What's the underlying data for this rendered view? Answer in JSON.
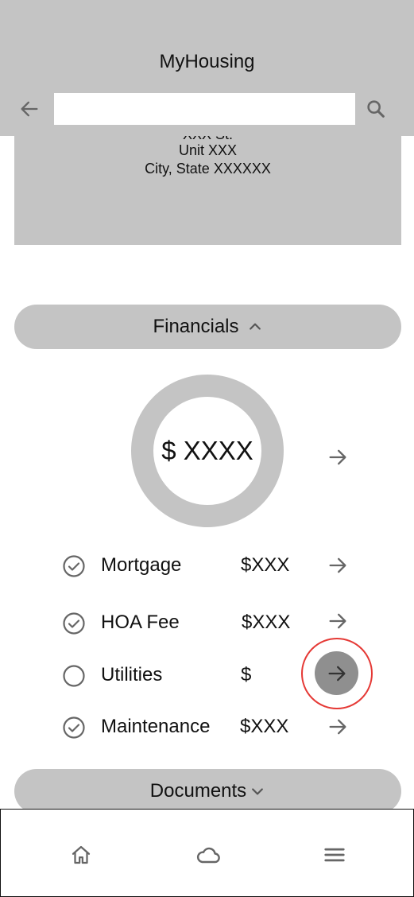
{
  "header": {
    "title": "MyHousing",
    "search": {
      "value": "",
      "placeholder": ""
    }
  },
  "address": {
    "line1": "XXX St.",
    "line2": "Unit XXX",
    "line3": "City, State XXXXXX"
  },
  "financials": {
    "label": "Financials",
    "expanded": true,
    "total": "$ XXXX",
    "items": [
      {
        "label": "Mortgage",
        "amount": "$XXX",
        "status": "checked"
      },
      {
        "label": "HOA Fee",
        "amount": "$XXX",
        "status": "checked"
      },
      {
        "label": "Utilities",
        "amount": "$",
        "status": "unchecked",
        "highlighted": true
      },
      {
        "label": "Maintenance",
        "amount": "$XXX",
        "status": "checked"
      }
    ]
  },
  "documents": {
    "label": "Documents",
    "expanded": false
  },
  "bottom_nav": {
    "items": [
      {
        "icon": "home-icon"
      },
      {
        "icon": "cloud-icon"
      },
      {
        "icon": "menu-icon"
      }
    ]
  },
  "colors": {
    "surface_gray": "#c4c4c4",
    "icon_gray": "#666666",
    "highlight_red": "#e53935",
    "active_button_gray": "#8f8f8f"
  }
}
